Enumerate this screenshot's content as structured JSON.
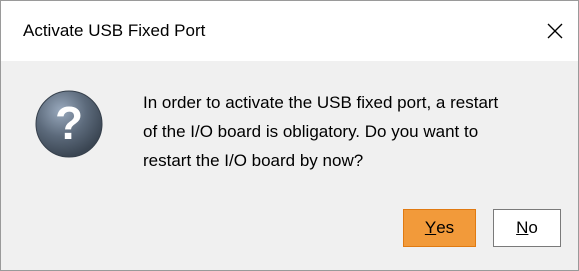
{
  "dialog": {
    "title": "Activate USB Fixed Port",
    "close_icon": "close-icon",
    "question_icon": "question-icon",
    "message_lines": [
      "In order to activate the USB fixed port, a restart",
      "of the I/O board is obligatory. Do you want to",
      "restart the I/O board by now?"
    ],
    "buttons": {
      "yes": {
        "mnemonic": "Y",
        "rest": "es"
      },
      "no": {
        "mnemonic": "N",
        "rest": "o"
      }
    },
    "colors": {
      "yes_button_bg": "#f29a3a",
      "yes_button_border": "#e07a12",
      "icon_gradient_light": "#8fa0b4",
      "icon_gradient_dark": "#3f4c5c"
    }
  }
}
